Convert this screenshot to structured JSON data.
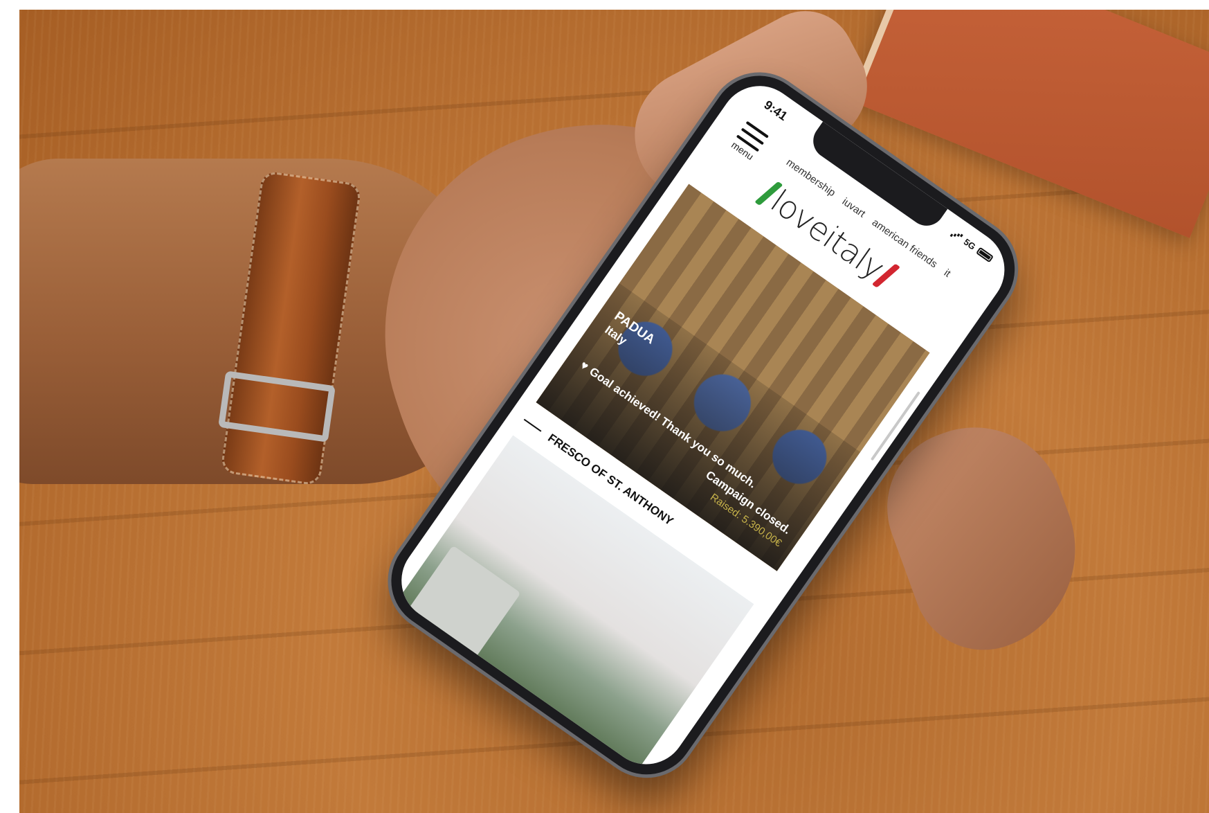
{
  "status_bar": {
    "time": "9:41",
    "network": "5G"
  },
  "header": {
    "menu_label": "menu",
    "nav": [
      {
        "label": "membership"
      },
      {
        "label": "iuvart"
      },
      {
        "label": "american friends"
      },
      {
        "label": "it"
      }
    ],
    "logo_text": "loveitaly",
    "logo_colors": {
      "green": "#2e9b3c",
      "red": "#d22630"
    }
  },
  "campaign": {
    "city": "PADUA",
    "country": "Italy",
    "goal_message": "Goal achieved! Thank you so much.",
    "status": "Campaign closed.",
    "raised": "Raised: 5.390,00€"
  },
  "section": {
    "title": "FRESCO OF ST. ANTHONY"
  },
  "colors": {
    "accent_gold": "#c8b44a",
    "strap_brown": "#9a4c1e",
    "wood": "#c27a3a"
  }
}
